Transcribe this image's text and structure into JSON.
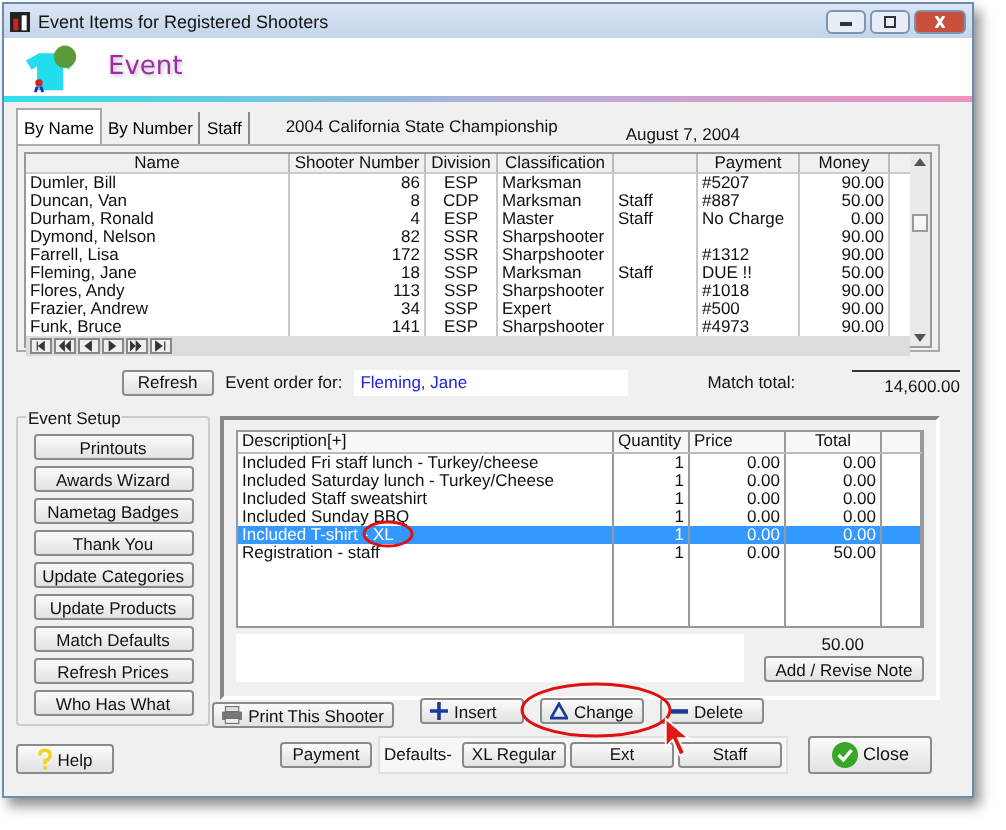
{
  "window": {
    "title": "Event Items for Registered Shooters"
  },
  "header": {
    "title": "Event"
  },
  "tabs": [
    {
      "label": "By Name",
      "selected": true
    },
    {
      "label": "By Number",
      "selected": false
    },
    {
      "label": "Staff",
      "selected": false
    }
  ],
  "event_name": "2004 California State Championship",
  "event_date": "August  7, 2004",
  "grid": {
    "columns": {
      "name": "Name",
      "number": "Shooter Number",
      "division": "Division",
      "classification": "Classification",
      "payment": "Payment",
      "money": "Money"
    },
    "rows": [
      {
        "name": "Dumler, Bill",
        "number": "86",
        "division": "ESP",
        "classification": "Marksman",
        "payment": "#5207",
        "money": "90.00"
      },
      {
        "name": "Duncan, Van",
        "number": "8",
        "division": "CDP",
        "classification": "Marksman",
        "column_5": "Staff",
        "payment": "#887",
        "money": "50.00"
      },
      {
        "name": "Durham, Ronald",
        "number": "4",
        "division": "ESP",
        "classification": "Master",
        "column_5": "Staff",
        "payment": "No Charge",
        "money": "0.00"
      },
      {
        "name": "Dymond, Nelson",
        "number": "82",
        "division": "SSR",
        "classification": "Sharpshooter",
        "money": "90.00"
      },
      {
        "name": "Farrell, Lisa",
        "number": "172",
        "division": "SSR",
        "classification": "Sharpshooter",
        "payment": "#1312",
        "money": "90.00"
      },
      {
        "name": "Fleming, Jane",
        "number": "18",
        "division": "SSP",
        "classification": "Marksman",
        "column_5": "Staff",
        "payment": "DUE !!",
        "money": "50.00"
      },
      {
        "name": "Flores, Andy",
        "number": "113",
        "division": "SSP",
        "classification": "Sharpshooter",
        "payment": "#1018",
        "money": "90.00"
      },
      {
        "name": "Frazier, Andrew",
        "number": "34",
        "division": "SSP",
        "classification": "Expert",
        "payment": "#500",
        "money": "90.00"
      },
      {
        "name": "Funk, Bruce",
        "number": "141",
        "division": "ESP",
        "classification": "Sharpshooter",
        "payment": "#4973",
        "money": "90.00"
      }
    ]
  },
  "refresh_button": "Refresh",
  "order_for": {
    "label": "Event order for:",
    "value": "Fleming, Jane"
  },
  "match_total": {
    "label": "Match total:",
    "value": "14,600.00"
  },
  "event_setup": {
    "title": "Event Setup",
    "buttons": [
      "Printouts",
      "Awards Wizard",
      "Nametag Badges",
      "Thank You",
      "Update Categories",
      "Update Products",
      "Match Defaults",
      "Refresh Prices",
      "Who Has What"
    ]
  },
  "order_items": {
    "columns": {
      "description": "Description[+]",
      "quantity": "Quantity",
      "price": "Price",
      "total": "Total"
    },
    "rows": [
      {
        "description": "Included Fri staff lunch - Turkey/cheese",
        "quantity": "1",
        "price": "0.00",
        "total": "0.00",
        "selected": false
      },
      {
        "description": "Included Saturday lunch - Turkey/Cheese",
        "quantity": "1",
        "price": "0.00",
        "total": "0.00",
        "selected": false
      },
      {
        "description": "Included Staff sweatshirt",
        "quantity": "1",
        "price": "0.00",
        "total": "0.00",
        "selected": false
      },
      {
        "description": "Included Sunday BBQ",
        "quantity": "1",
        "price": "0.00",
        "total": "0.00",
        "selected": false
      },
      {
        "description": "Included T-shirt - XL",
        "quantity": "1",
        "price": "0.00",
        "total": "0.00",
        "selected": true
      },
      {
        "description": "Registration - staff",
        "quantity": "1",
        "price": "0.00",
        "total": "50.00",
        "selected": false
      }
    ]
  },
  "order_total": "50.00",
  "add_note_button": "Add / Revise Note",
  "print_button": "Print This Shooter",
  "item_buttons": [
    {
      "label": "Insert",
      "kind": "plus"
    },
    {
      "label": "Change",
      "kind": "triangle"
    },
    {
      "label": "Delete",
      "kind": "minus"
    }
  ],
  "payment_button": "Payment",
  "defaults": {
    "label": "Defaults-",
    "buttons": [
      "XL Regular",
      "Ext",
      "Staff"
    ]
  },
  "close_button": "Close",
  "help_button": "Help"
}
